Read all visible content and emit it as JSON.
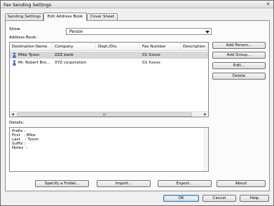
{
  "window": {
    "title": "Fax Sending Settings",
    "close_glyph": "✕"
  },
  "tabs": [
    {
      "label": "Sending Settings",
      "active": false
    },
    {
      "label": "Edit Address Book",
      "active": true
    },
    {
      "label": "Cover Sheet",
      "active": false
    }
  ],
  "show": {
    "label": "Show:",
    "value": "Person"
  },
  "address_book": {
    "label": "Address Book:",
    "columns": [
      "Destination Name",
      "Company",
      "Dept./Div.",
      "Fax Number",
      "Description"
    ],
    "rows": [
      {
        "name": "Mike Tyson",
        "company": "ZZZ bank",
        "dept": "",
        "fax": "01 Xxxxx",
        "description": "",
        "selected": true,
        "icon": "person-icon"
      },
      {
        "name": "Mr. Robert Bro...",
        "company": "XYZ corporation",
        "dept": "",
        "fax": "01 Xxxxx",
        "description": "",
        "selected": false,
        "icon": "person-icon"
      }
    ],
    "scroll_grip": "III"
  },
  "side_buttons": {
    "add_person": "Add Person...",
    "add_group": "Add Group...",
    "edit": "Edit...",
    "delete": "Delete"
  },
  "details": {
    "label": "Details:",
    "lines": [
      "Prefix :",
      "First   : Mike",
      "Last    : Tyson",
      "Suffix : ",
      "Notes  :"
    ]
  },
  "bottom_buttons": {
    "specify_folder": "Specify a Folder...",
    "import": "Import...",
    "export": "Export...",
    "about": "About"
  },
  "dialog_buttons": {
    "ok": "OK",
    "cancel": "Cancel",
    "help": "Help"
  },
  "colors": {
    "selection": "#d8d8d8",
    "person_icon": "#3a6fd0",
    "default_button_border": "#3c7fb1"
  }
}
